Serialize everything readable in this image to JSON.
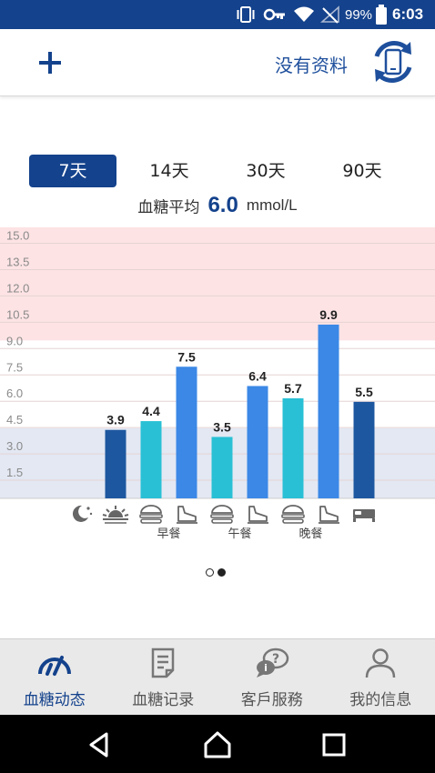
{
  "status_bar": {
    "battery": "99%",
    "time": "6:03"
  },
  "header": {
    "no_data": "没有资料"
  },
  "range_tabs": [
    {
      "label": "7天",
      "active": true
    },
    {
      "label": "14天",
      "active": false
    },
    {
      "label": "30天",
      "active": false
    },
    {
      "label": "90天",
      "active": false
    }
  ],
  "average": {
    "label": "血糖平均",
    "value": "6.0",
    "unit": "mmol/L"
  },
  "chart_data": {
    "type": "bar",
    "ylim": [
      0,
      16.5
    ],
    "yticks": [
      "15.0",
      "13.5",
      "12.0",
      "10.5",
      "9.0",
      "7.5",
      "6.0",
      "4.5",
      "3.0",
      "1.5"
    ],
    "ytick_values": [
      15.0,
      13.5,
      12.0,
      10.5,
      9.0,
      7.5,
      6.0,
      4.5,
      3.0,
      1.5
    ],
    "high_band": [
      9.0,
      16.5
    ],
    "low_band": [
      0,
      4.0
    ],
    "slots": [
      {
        "icon": "night-icon",
        "value": null
      },
      {
        "icon": "sunrise-icon",
        "value": 3.9,
        "label": "3.9",
        "kind": "dark"
      },
      {
        "icon": "before-meal-icon",
        "value": 4.4,
        "label": "4.4",
        "kind": "teal"
      },
      {
        "icon": "after-meal-icon",
        "value": 7.5,
        "label": "7.5",
        "kind": "blue"
      },
      {
        "icon": "before-meal-icon",
        "value": 3.5,
        "label": "3.5",
        "kind": "teal"
      },
      {
        "icon": "after-meal-icon",
        "value": 6.4,
        "label": "6.4",
        "kind": "blue"
      },
      {
        "icon": "before-meal-icon",
        "value": 5.7,
        "label": "5.7",
        "kind": "teal"
      },
      {
        "icon": "after-meal-icon",
        "value": 9.9,
        "label": "9.9",
        "kind": "blue"
      },
      {
        "icon": "bed-icon",
        "value": 5.5,
        "label": "5.5",
        "kind": "dark"
      }
    ],
    "meal_groups": [
      "早餐",
      "午餐",
      "晚餐"
    ]
  },
  "bottom_nav": [
    {
      "label": "血糖动态",
      "icon": "gauge-icon",
      "active": true
    },
    {
      "label": "血糖记录",
      "icon": "notes-icon",
      "active": false
    },
    {
      "label": "客戶服務",
      "icon": "support-chat-icon",
      "active": false
    },
    {
      "label": "我的信息",
      "icon": "profile-icon",
      "active": false
    }
  ],
  "colors": {
    "primary": "#14428c",
    "high_band": "#fde3e4",
    "low_band": "#e3e8f3",
    "bar_dark": "#1d579f",
    "bar_teal": "#29c0d5",
    "bar_blue": "#3b88e6"
  }
}
